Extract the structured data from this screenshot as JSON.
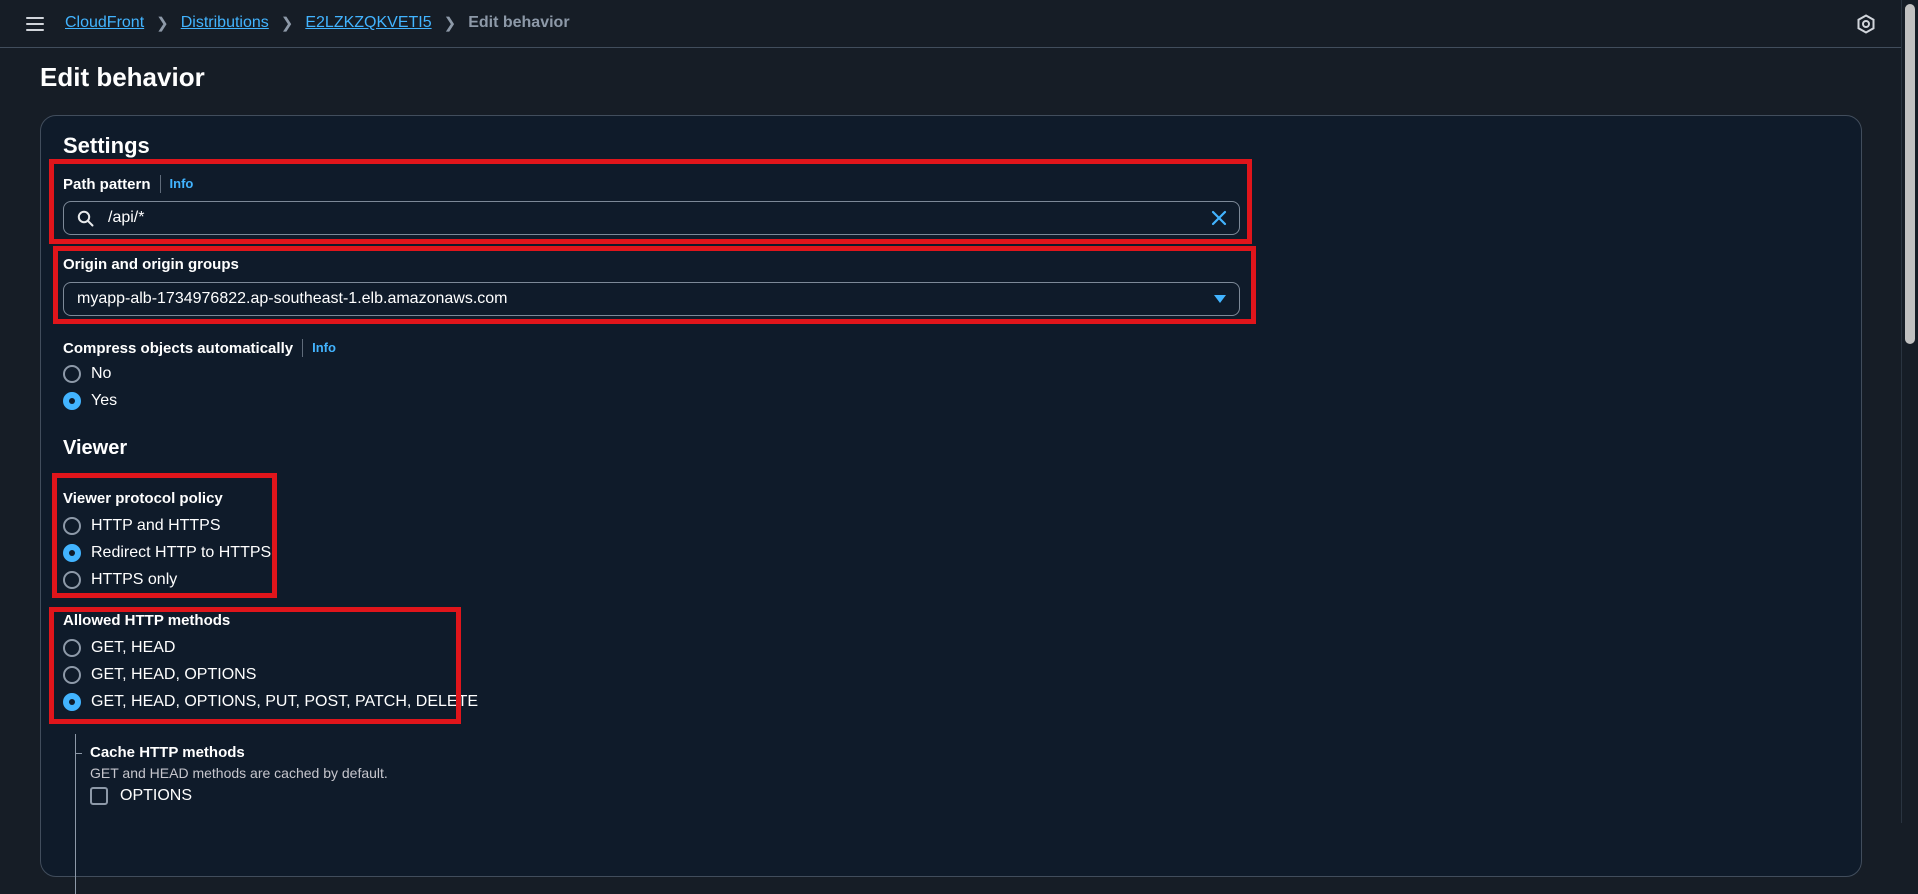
{
  "breadcrumb": {
    "items": [
      "CloudFront",
      "Distributions",
      "E2LZKZQKVETI5"
    ],
    "current": "Edit behavior"
  },
  "page": {
    "title": "Edit behavior"
  },
  "settings": {
    "heading": "Settings",
    "path_pattern": {
      "label": "Path pattern",
      "info": "Info",
      "value": "/api/*"
    },
    "origin": {
      "label": "Origin and origin groups",
      "value": "myapp-alb-1734976822.ap-southeast-1.elb.amazonaws.com"
    },
    "compress": {
      "label": "Compress objects automatically",
      "info": "Info",
      "options": [
        "No",
        "Yes"
      ],
      "selected": "Yes"
    }
  },
  "viewer": {
    "heading": "Viewer",
    "protocol_policy": {
      "label": "Viewer protocol policy",
      "options": [
        "HTTP and HTTPS",
        "Redirect HTTP to HTTPS",
        "HTTPS only"
      ],
      "selected": "Redirect HTTP to HTTPS"
    },
    "allowed_methods": {
      "label": "Allowed HTTP methods",
      "options": [
        "GET, HEAD",
        "GET, HEAD, OPTIONS",
        "GET, HEAD, OPTIONS, PUT, POST, PATCH, DELETE"
      ],
      "selected": "GET, HEAD, OPTIONS, PUT, POST, PATCH, DELETE"
    },
    "cache_methods": {
      "label": "Cache HTTP methods",
      "description": "GET and HEAD methods are cached by default.",
      "options": [
        "OPTIONS"
      ],
      "checked": false
    }
  },
  "colors": {
    "background": "#161d26",
    "accent": "#42b4ff",
    "highlight": "#e0151b"
  },
  "icons": {
    "menu": "hamburger-icon",
    "settings": "hexagon-icon",
    "search": "search-icon",
    "clear": "close-icon",
    "dropdown": "caret-down-icon"
  }
}
